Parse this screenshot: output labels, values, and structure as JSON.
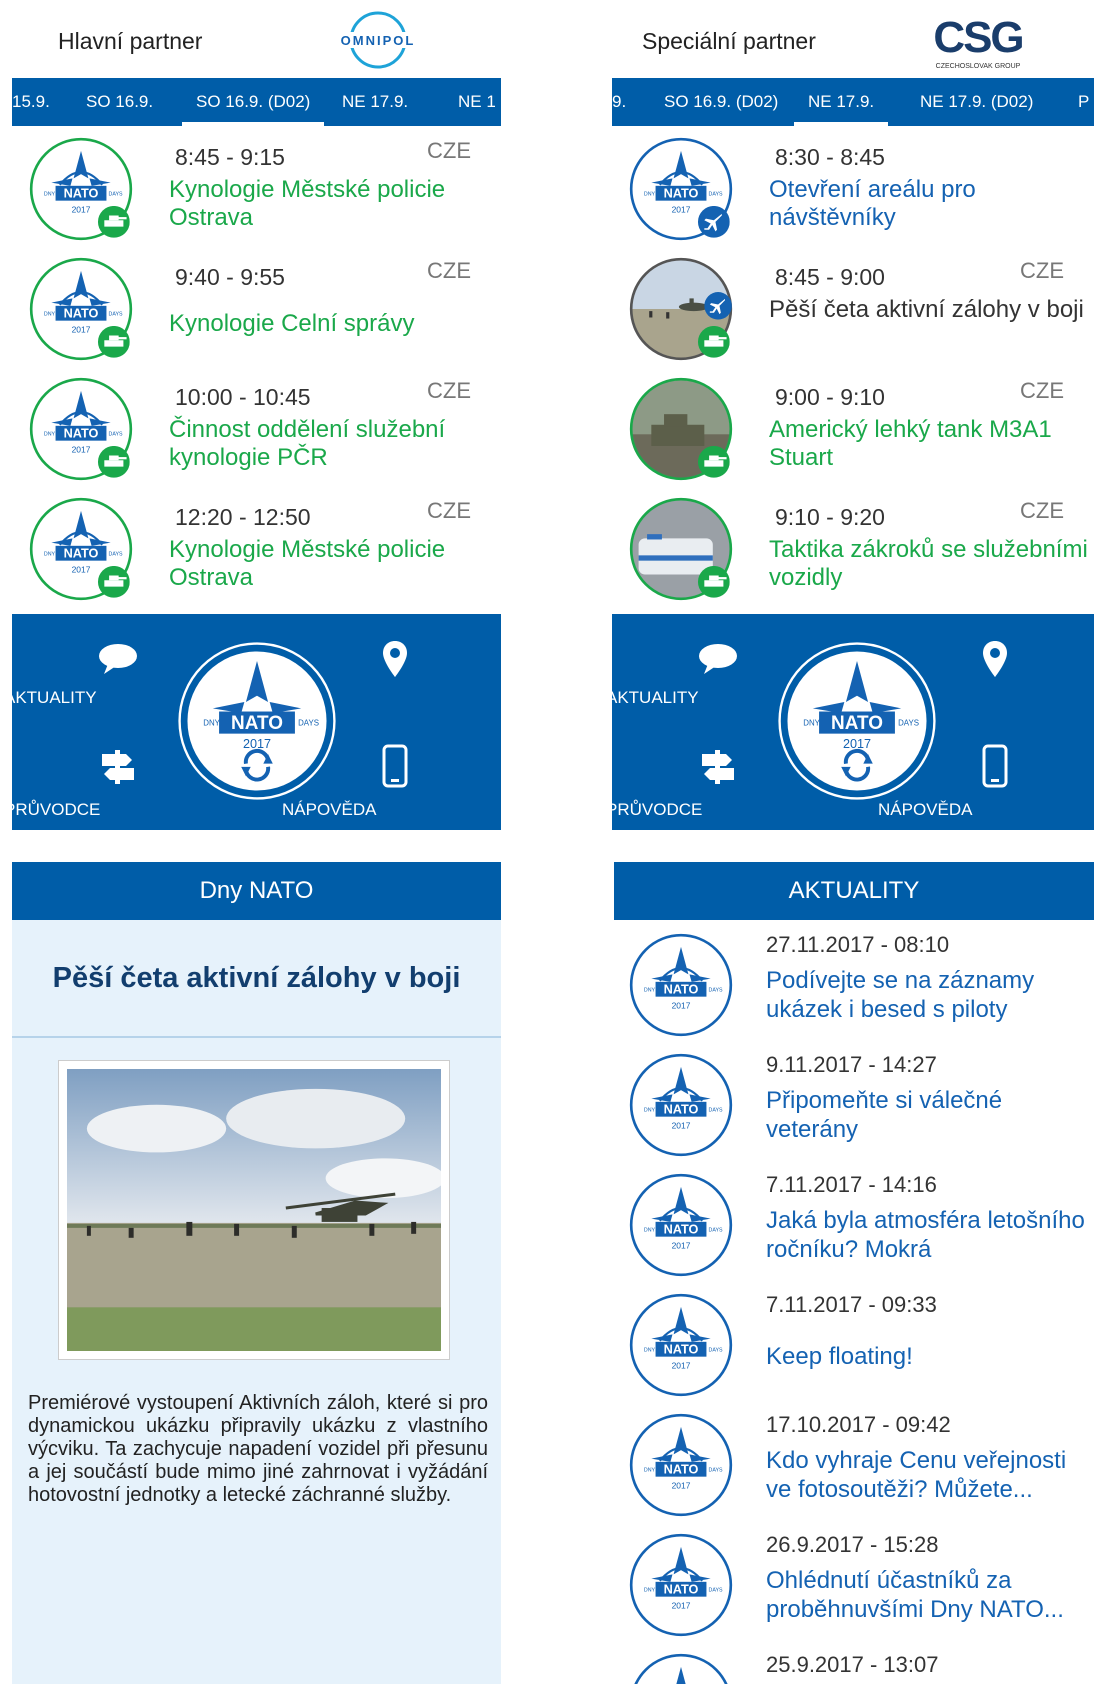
{
  "panel1": {
    "partner_label": "Hlavní partner",
    "partner_logo_text": "OMNIPOL",
    "tabs": [
      "15.9.",
      "SO 16.9.",
      "SO 16.9. (D02)",
      "NE 17.9.",
      "NE 1"
    ],
    "events": [
      {
        "time": "8:45 -  9:15",
        "lang": "CZE",
        "title": "Kynologie Městské policie Ostrava"
      },
      {
        "time": "9:40 -  9:55",
        "lang": "CZE",
        "title": "Kynologie Celní správy"
      },
      {
        "time": "10:00 - 10:45",
        "lang": "CZE",
        "title": "Činnost oddělení služební kynologie PČR"
      },
      {
        "time": "12:20 - 12:50",
        "lang": "CZE",
        "title": "Kynologie Městské policie Ostrava"
      }
    ],
    "nav": {
      "news": "AKTUALITY",
      "guide": "PRŮVODCE",
      "help": "NÁPOVĚDA"
    }
  },
  "panel2": {
    "partner_label": "Speciální partner",
    "partner_logo_text": "CSG",
    "partner_logo_sub": "CZECHOSLOVAK GROUP",
    "tabs": [
      "9.",
      "SO 16.9. (D02)",
      "NE 17.9.",
      "NE 17.9. (D02)",
      "P"
    ],
    "events": [
      {
        "time": "8:30 -  8:45",
        "lang": "",
        "title": "Otevření areálu pro návštěvníky"
      },
      {
        "time": "8:45 -  9:00",
        "lang": "CZE",
        "title": "Pěší četa aktivní zálohy v boji"
      },
      {
        "time": "9:00 -  9:10",
        "lang": "CZE",
        "title": "Americký lehký tank M3A1 Stuart"
      },
      {
        "time": "9:10 -  9:20",
        "lang": "CZE",
        "title": "Taktika zákroků se služebními vozidly"
      }
    ],
    "nav": {
      "news": "AKTUALITY",
      "guide": "PRŮVODCE",
      "help": "NÁPOVĚDA"
    }
  },
  "panel3": {
    "header": "Dny NATO",
    "title": "Pěší četa aktivní zálohy v boji",
    "body": "Premiérové vystoupení Aktivních záloh, které si pro dynamickou ukázku připravily ukázku z vlastního výcviku. Ta zachycuje napadení vozidel při přesunu a jej součástí bude mimo jiné zahrnovat i vyžádání hotovostní jednotky a letecké záchranné služby."
  },
  "panel4": {
    "header": "AKTUALITY",
    "news": [
      {
        "date": "27.11.2017 - 08:10",
        "title": "Podívejte se na záznamy ukázek i besed s piloty"
      },
      {
        "date": "9.11.2017 - 14:27",
        "title": "Připomeňte si válečné veterány"
      },
      {
        "date": "7.11.2017 - 14:16",
        "title": "Jaká byla atmosféra letošního ročníku? Mokrá"
      },
      {
        "date": "7.11.2017 - 09:33",
        "title": "Keep floating!"
      },
      {
        "date": "17.10.2017 - 09:42",
        "title": "Kdo vyhraje Cenu veřejnosti ve fotosoutěži? Můžete..."
      },
      {
        "date": "26.9.2017 - 15:28",
        "title": "Ohlédnutí účastníků za proběhnuvšími Dny NATO..."
      },
      {
        "date": "25.9.2017 - 13:07",
        "title": ""
      }
    ]
  },
  "badge_text": {
    "nato": "NATO",
    "dny": "DNY",
    "days": "DAYS",
    "year": "2017"
  },
  "colors": {
    "primary": "#005da8",
    "green": "#1aa84a",
    "link_blue": "#1462b2",
    "article_bg": "#e6f2fb"
  }
}
